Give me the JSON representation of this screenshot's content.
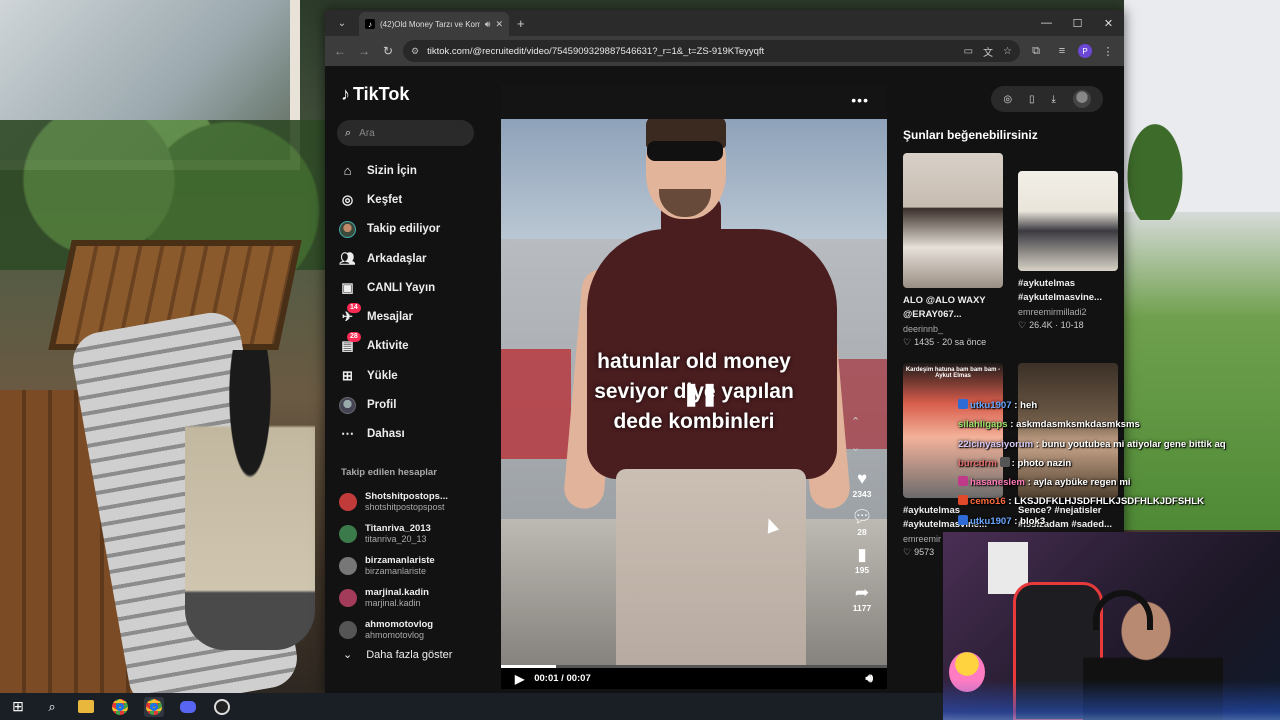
{
  "browser": {
    "tab_title": "(42)Old Money Tarzı ve Kom",
    "tab_favicon": "tiktok-icon",
    "url": "tiktok.com/@recruitedit/video/7545909329887546631?_r=1&_t=ZS-919KTeyyqft",
    "profile_initial": "P"
  },
  "tiktok": {
    "logo": "TikTok",
    "search_placeholder": "Ara",
    "nav": [
      {
        "label": "Sizin İçin",
        "icon": "home-icon"
      },
      {
        "label": "Keşfet",
        "icon": "compass-icon"
      },
      {
        "label": "Takip ediliyor",
        "icon": "following-avatar-icon"
      },
      {
        "label": "Arkadaşlar",
        "icon": "friends-icon"
      },
      {
        "label": "CANLI Yayın",
        "icon": "live-icon"
      },
      {
        "label": "Mesajlar",
        "icon": "messages-icon",
        "badge": "14"
      },
      {
        "label": "Aktivite",
        "icon": "activity-icon",
        "badge": "28"
      },
      {
        "label": "Yükle",
        "icon": "upload-icon"
      },
      {
        "label": "Profil",
        "icon": "profile-icon"
      },
      {
        "label": "Dahası",
        "icon": "more-icon"
      }
    ],
    "following_title": "Takip edilen hesaplar",
    "following": [
      {
        "name": "Shotshitpostops...",
        "handle": "shotshitpostopspost",
        "color": "#c23b3b"
      },
      {
        "name": "Titanriva_2013",
        "handle": "titanriva_20_13",
        "color": "#3b7a4a"
      },
      {
        "name": "birzamanlariste",
        "handle": "birzamanlariste",
        "color": "#777777"
      },
      {
        "name": "marjinal.kadin",
        "handle": "marjinal.kadin",
        "color": "#a33b5a"
      },
      {
        "name": "ahmomotovlog",
        "handle": "ahmomotovlog",
        "color": "#555555"
      }
    ],
    "more_label": "Daha fazla göster"
  },
  "video": {
    "caption_lines": [
      "hatunlar old money",
      "seviyor diye yapılan",
      "dede kombinleri"
    ],
    "likes": "2343",
    "comments": "28",
    "saves": "195",
    "shares": "1177",
    "time": "00:01 / 00:07",
    "progress": 0.143
  },
  "suggestions": {
    "title": "Şunları beğenebilirsiniz",
    "cards": [
      {
        "title": "ALO @ALO WAXY @ERAY067...",
        "user": "deerinnb_",
        "meta": "1435 · 20 sa önce"
      },
      {
        "title": "#aykutelmas #aykutelmasvine...",
        "user": "emreemirmilladi2",
        "meta": "26.4K · 10-18"
      },
      {
        "title": "#aykutelmas #aykutelmasvine...",
        "user": "emreemir",
        "meta": "9573",
        "thumb_text": "Kardeşim hatuna bam bam bam - Aykut Elmas"
      },
      {
        "title": "Sence? #nejatisler #issizadam #saded...",
        "user": "",
        "meta": ""
      }
    ]
  },
  "chat": [
    {
      "user": "utku1907",
      "msg": ": heh",
      "color": "#6aa8ff",
      "icon": "#2f6bd6"
    },
    {
      "user": "silahligaps",
      "msg": ": askmdasmksmkdasmksms",
      "color": "#9be06a",
      "icon": ""
    },
    {
      "user": "22icinyasiyorum",
      "msg": ": bunu youtubea mi atiyolar gene bittik aq",
      "color": "#d7c9f5",
      "icon": ""
    },
    {
      "user": "burcdrm",
      "msg": ": photo nazin",
      "color": "#e06b6b",
      "icon": "#555"
    },
    {
      "user": "hasaneslem",
      "msg": ": ayla aybüke regen mi",
      "color": "#ff7ab6",
      "icon": "#c03a8a"
    },
    {
      "user": "cemo16",
      "msg": ": LKSJDFKLHJSDFHLKJSDFHLKJDFSHLK",
      "color": "#ff6b3d",
      "icon": "#e04a2a"
    },
    {
      "user": "utku1907",
      "msg": ": blok3",
      "color": "#6aa8ff",
      "icon": "#2f6bd6"
    }
  ],
  "taskbar": {
    "icons": [
      "windows-start-icon",
      "search-icon",
      "file-explorer-icon",
      "chrome-icon",
      "chrome-icon-active",
      "discord-icon",
      "obs-icon"
    ]
  }
}
